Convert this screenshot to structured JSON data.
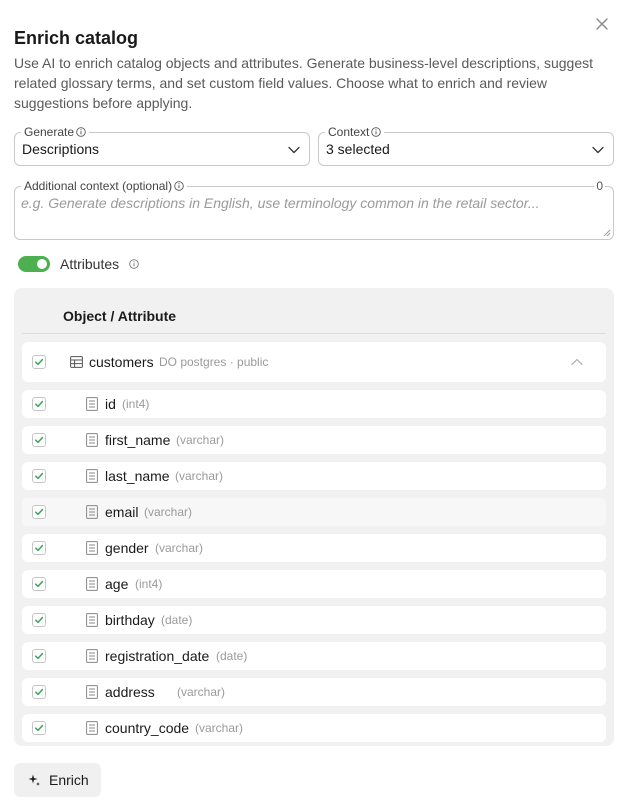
{
  "dialog": {
    "title": "Enrich catalog",
    "description": "Use AI to enrich catalog objects and attributes. Generate business-level descriptions, suggest related glossary terms, and set custom field values. Choose what to enrich and review suggestions before applying."
  },
  "generate": {
    "label": "Generate",
    "value": "Descriptions"
  },
  "context": {
    "label": "Context",
    "value": "3 selected"
  },
  "additional_context": {
    "label": "Additional context (optional)",
    "placeholder": "e.g. Generate descriptions in English, use terminology common in the retail sector...",
    "char_count": "0"
  },
  "attributes_toggle": {
    "label": "Attributes",
    "enabled": true
  },
  "table": {
    "header": "Object / Attribute",
    "object": {
      "name": "customers",
      "meta": "DO postgres · public",
      "checked": true,
      "expanded": true
    },
    "attributes": [
      {
        "name": "id",
        "type": "(int4)",
        "checked": true
      },
      {
        "name": "first_name",
        "type": "(varchar)",
        "checked": true
      },
      {
        "name": "last_name",
        "type": "(varchar)",
        "checked": true
      },
      {
        "name": "email",
        "type": "(varchar)",
        "checked": true
      },
      {
        "name": "gender",
        "type": "(varchar)",
        "checked": true
      },
      {
        "name": "age",
        "type": "(int4)",
        "checked": true
      },
      {
        "name": "birthday",
        "type": "(date)",
        "checked": true
      },
      {
        "name": "registration_date",
        "type": "(date)",
        "checked": true
      },
      {
        "name": "address",
        "type": "(varchar)",
        "checked": true
      },
      {
        "name": "country_code",
        "type": "(varchar)",
        "checked": true
      }
    ]
  },
  "actions": {
    "enrich_label": "Enrich"
  },
  "colors": {
    "accent_green": "#4caf50",
    "check_green": "#3aa35a",
    "panel_bg": "#f1f1f1"
  },
  "icons": {
    "close": "close-icon",
    "info": "info-icon",
    "chevron": "chevron-down-icon",
    "table": "table-icon",
    "column": "column-icon",
    "collapse": "chevron-up-icon",
    "sparkle": "sparkle-icon"
  }
}
